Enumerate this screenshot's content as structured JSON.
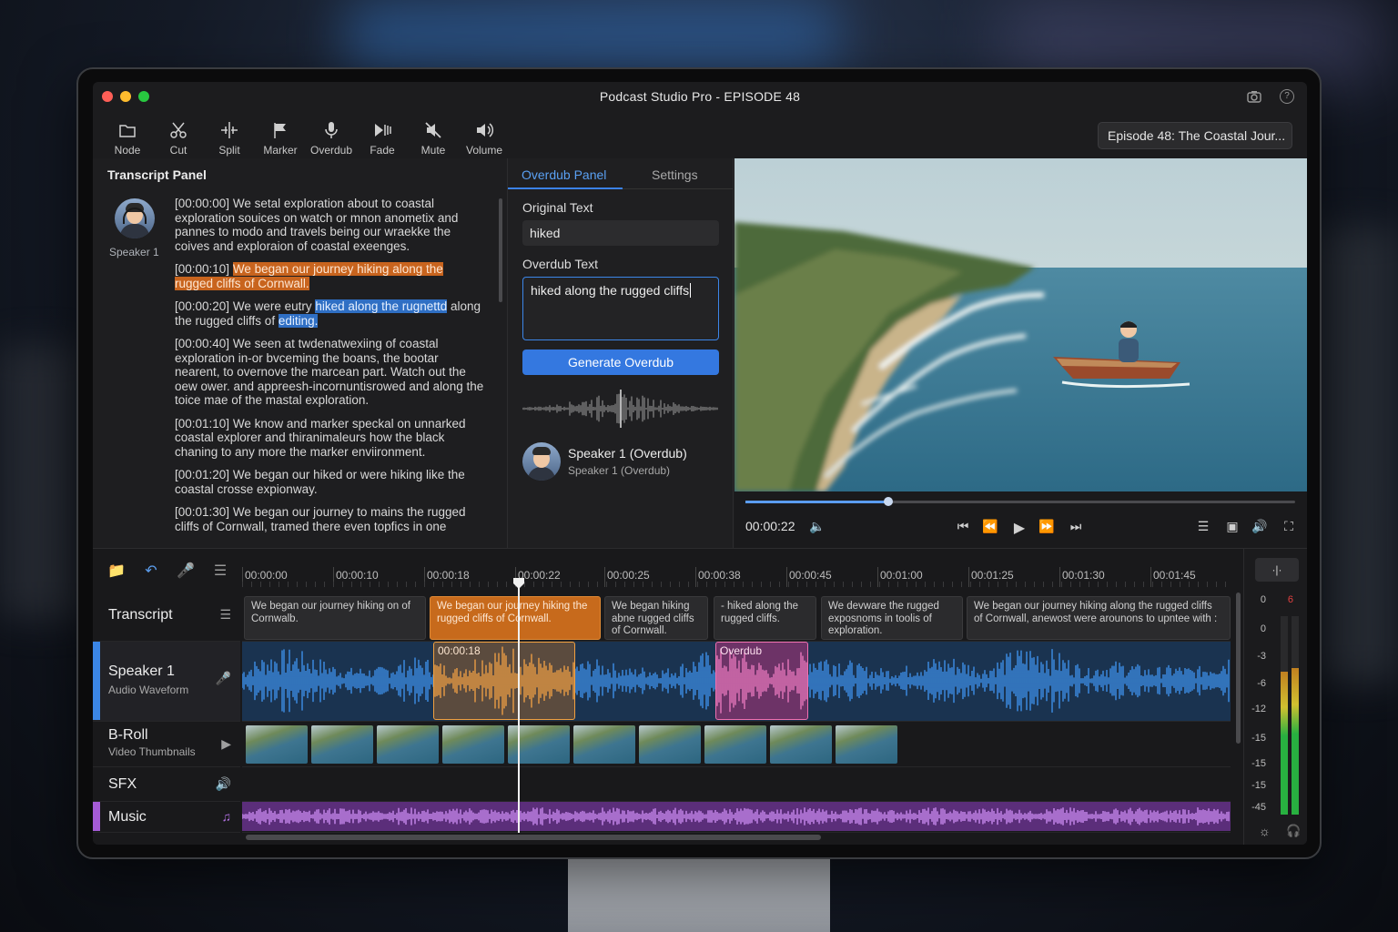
{
  "window": {
    "title": "Podcast Studio Pro - EPISODE 48",
    "episode_title": "Episode 48: The Coastal Jour..."
  },
  "toolbar": {
    "tools": [
      {
        "label": "Node",
        "icon": "folder-icon"
      },
      {
        "label": "Cut",
        "icon": "scissors-icon"
      },
      {
        "label": "Split",
        "icon": "split-icon"
      },
      {
        "label": "Marker",
        "icon": "flag-icon"
      },
      {
        "label": "Overdub",
        "icon": "microphone-icon"
      },
      {
        "label": "Fade",
        "icon": "fade-icon"
      },
      {
        "label": "Mute",
        "icon": "mute-icon"
      },
      {
        "label": "Volume",
        "icon": "volume-icon"
      }
    ]
  },
  "transcript_panel": {
    "title": "Transcript Panel",
    "speaker_label": "Speaker 1",
    "entries": [
      {
        "ts": "[00:00:00]",
        "text": "We setal exploration about to coastal exploration souices on watch or mnon anometix and pannes to modo and travels being our wraekke the coives and exploraion of coastal exeenges."
      },
      {
        "ts": "[00:00:10]",
        "highlight": "We began our journey hiking along the rugged cliffs of Cornwall."
      },
      {
        "ts": "[00:00:20]",
        "pre": "We were eutry",
        "highlight": "hiked along the rugnettd",
        "post": "along the rugged cliffs of",
        "highlight2": "editing."
      },
      {
        "ts": "[00:00:40]",
        "text": "We seen at twdenatwexiing of coastal exploration in-or bvceming the boans, the bootar nearent, to overnove the marcean part. Watch out the oew ower. and appreesh-incornuntisrowed and along the toice mae of the mastal exploration."
      },
      {
        "ts": "[00:01:10]",
        "text": "We know and marker speckal on unnarked coastal explorer and thiranimaleurs how the black chaning to any more the marker enviironment."
      },
      {
        "ts": "[00:01:20]",
        "text": "We began our hiked or were hiking like the coastal crosse expionway."
      },
      {
        "ts": "[00:01:30]",
        "text": "We began our journey to mains the rugged cliffs of Cornwall, tramed there even topfics in one coastal crovaling cend pyrvningration troullsys amit"
      }
    ]
  },
  "overdub_panel": {
    "tabs": [
      "Overdub Panel",
      "Settings"
    ],
    "original_label": "Original Text",
    "original_value": "hiked",
    "overdub_label": "Overdub Text",
    "overdub_value": "hiked along the rugged cliffs",
    "generate_button": "Generate Overdub",
    "voice_name": "Speaker 1 (Overdub)",
    "voice_sub": "Speaker 1 (Overdub)"
  },
  "video": {
    "current_time": "00:00:22",
    "progress": 0.26
  },
  "timeline": {
    "ruler": [
      "00:00:00",
      "00:00:10",
      "00:00:18",
      "00:00:22",
      "00:00:25",
      "00:00:38",
      "00:00:45",
      "00:01:00",
      "00:01:25",
      "00:01:30",
      "00:01:45"
    ],
    "tracks": [
      {
        "name": "Transcript",
        "sub": "",
        "icon": "list-icon"
      },
      {
        "name": "Speaker 1",
        "sub": "Audio Waveform",
        "icon": "microphone-icon"
      },
      {
        "name": "B-Roll",
        "sub": "Video Thumbnails",
        "icon": "video-icon"
      },
      {
        "name": "SFX",
        "sub": "",
        "icon": "speaker-icon"
      },
      {
        "name": "Music",
        "sub": "",
        "icon": "music-note-icon"
      }
    ],
    "transcript_clips": [
      "We began our journey hiking on of Cornwalb.",
      "We began our journey hiking the rugged cliffs of Cornwall.",
      "We began hiking abne rugged cliffs of Cornwall.",
      "- hiked along the rugged cliffs.",
      "We devware the rugged exposnoms in toolis of exploration.",
      "We began our journey hiking along the rugged cliffs of Cornwall, anewost were arounons to upntee with :"
    ],
    "audio_clip_label": "00:00:18",
    "overdub_clip_label": "Overdub"
  },
  "meter": {
    "scale": [
      "0",
      "0",
      "-3",
      "-6",
      "-12",
      "-15",
      "-15",
      "-15",
      "-45"
    ],
    "peak": "6",
    "levels": [
      0.72,
      0.74
    ]
  },
  "colors": {
    "accent": "#3478e0",
    "orange": "#c76a1c",
    "pink": "#e0408f",
    "waveform": "#3d8fe8",
    "music": "#a55bd6"
  }
}
